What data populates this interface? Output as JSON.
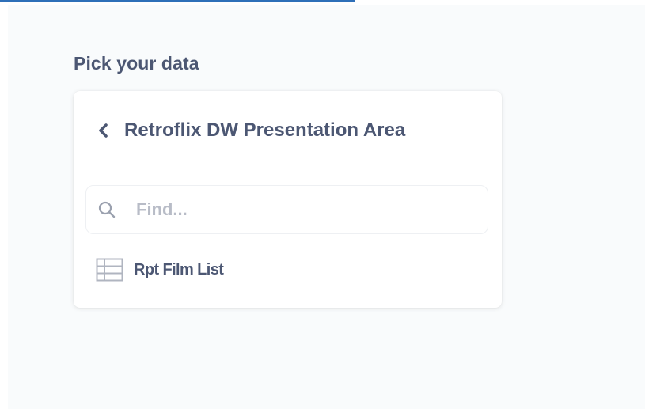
{
  "header": {
    "title": "Pick your data"
  },
  "picker": {
    "back_label": "Retroflix DW Presentation Area",
    "back_icon": "chevron-left-icon",
    "search": {
      "placeholder": "Find...",
      "value": "",
      "icon": "search-icon"
    },
    "items": [
      {
        "label": "Rpt Film List",
        "icon": "table-icon"
      }
    ]
  },
  "colors": {
    "text": "#4c5773",
    "placeholder": "#b8bcc7",
    "background": "#f9fbfc",
    "card": "#ffffff",
    "accent": "#2e6fb8"
  }
}
